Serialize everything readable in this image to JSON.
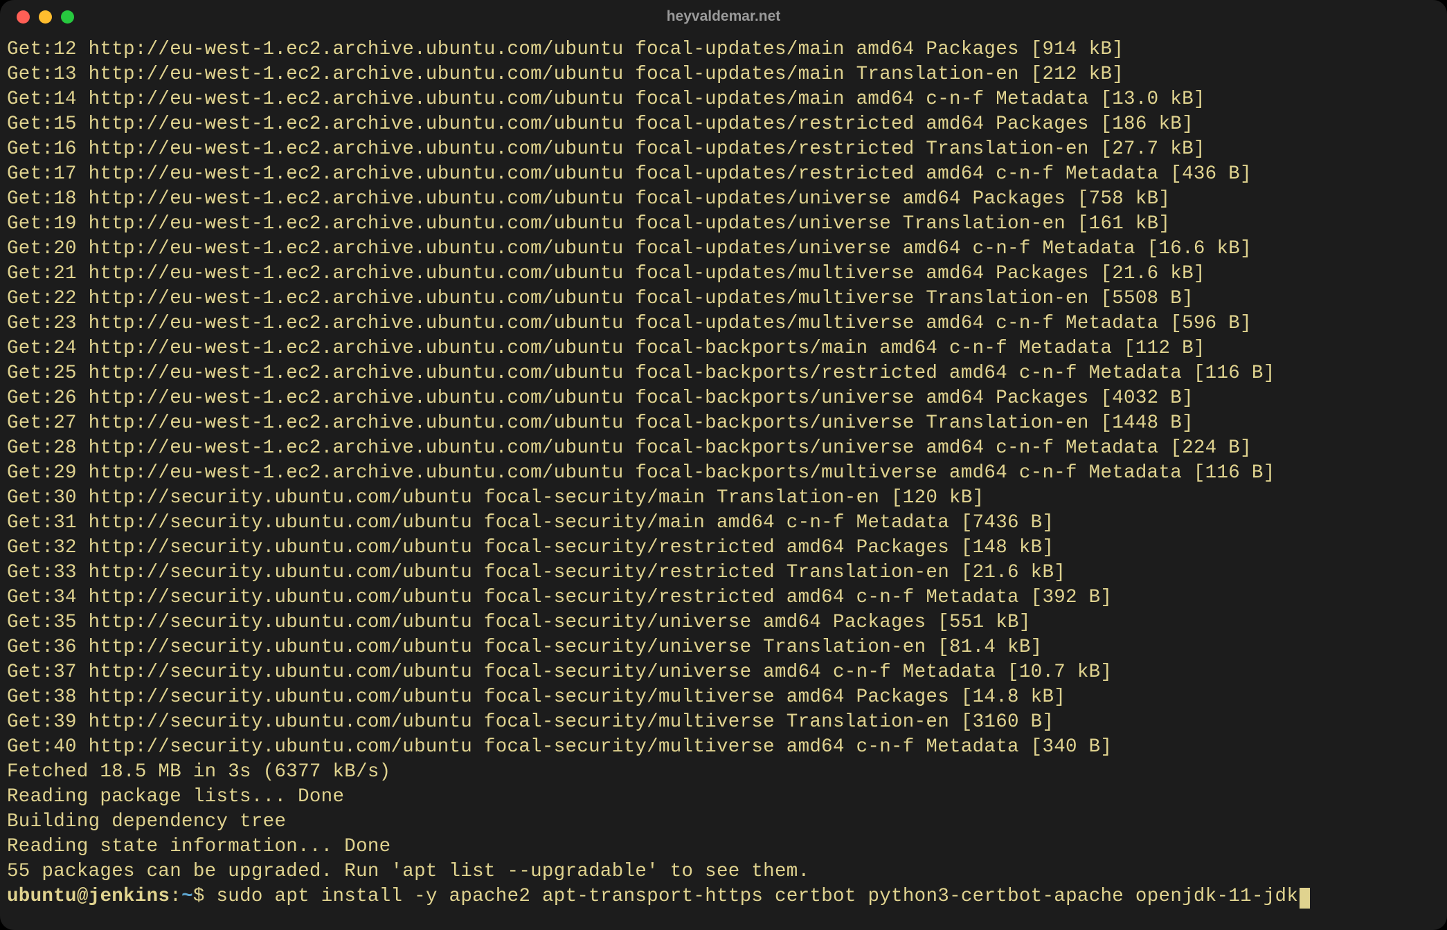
{
  "window": {
    "title": "heyvaldemar.net"
  },
  "lines": [
    "Get:12 http://eu-west-1.ec2.archive.ubuntu.com/ubuntu focal-updates/main amd64 Packages [914 kB]",
    "Get:13 http://eu-west-1.ec2.archive.ubuntu.com/ubuntu focal-updates/main Translation-en [212 kB]",
    "Get:14 http://eu-west-1.ec2.archive.ubuntu.com/ubuntu focal-updates/main amd64 c-n-f Metadata [13.0 kB]",
    "Get:15 http://eu-west-1.ec2.archive.ubuntu.com/ubuntu focal-updates/restricted amd64 Packages [186 kB]",
    "Get:16 http://eu-west-1.ec2.archive.ubuntu.com/ubuntu focal-updates/restricted Translation-en [27.7 kB]",
    "Get:17 http://eu-west-1.ec2.archive.ubuntu.com/ubuntu focal-updates/restricted amd64 c-n-f Metadata [436 B]",
    "Get:18 http://eu-west-1.ec2.archive.ubuntu.com/ubuntu focal-updates/universe amd64 Packages [758 kB]",
    "Get:19 http://eu-west-1.ec2.archive.ubuntu.com/ubuntu focal-updates/universe Translation-en [161 kB]",
    "Get:20 http://eu-west-1.ec2.archive.ubuntu.com/ubuntu focal-updates/universe amd64 c-n-f Metadata [16.6 kB]",
    "Get:21 http://eu-west-1.ec2.archive.ubuntu.com/ubuntu focal-updates/multiverse amd64 Packages [21.6 kB]",
    "Get:22 http://eu-west-1.ec2.archive.ubuntu.com/ubuntu focal-updates/multiverse Translation-en [5508 B]",
    "Get:23 http://eu-west-1.ec2.archive.ubuntu.com/ubuntu focal-updates/multiverse amd64 c-n-f Metadata [596 B]",
    "Get:24 http://eu-west-1.ec2.archive.ubuntu.com/ubuntu focal-backports/main amd64 c-n-f Metadata [112 B]",
    "Get:25 http://eu-west-1.ec2.archive.ubuntu.com/ubuntu focal-backports/restricted amd64 c-n-f Metadata [116 B]",
    "Get:26 http://eu-west-1.ec2.archive.ubuntu.com/ubuntu focal-backports/universe amd64 Packages [4032 B]",
    "Get:27 http://eu-west-1.ec2.archive.ubuntu.com/ubuntu focal-backports/universe Translation-en [1448 B]",
    "Get:28 http://eu-west-1.ec2.archive.ubuntu.com/ubuntu focal-backports/universe amd64 c-n-f Metadata [224 B]",
    "Get:29 http://eu-west-1.ec2.archive.ubuntu.com/ubuntu focal-backports/multiverse amd64 c-n-f Metadata [116 B]",
    "Get:30 http://security.ubuntu.com/ubuntu focal-security/main Translation-en [120 kB]",
    "Get:31 http://security.ubuntu.com/ubuntu focal-security/main amd64 c-n-f Metadata [7436 B]",
    "Get:32 http://security.ubuntu.com/ubuntu focal-security/restricted amd64 Packages [148 kB]",
    "Get:33 http://security.ubuntu.com/ubuntu focal-security/restricted Translation-en [21.6 kB]",
    "Get:34 http://security.ubuntu.com/ubuntu focal-security/restricted amd64 c-n-f Metadata [392 B]",
    "Get:35 http://security.ubuntu.com/ubuntu focal-security/universe amd64 Packages [551 kB]",
    "Get:36 http://security.ubuntu.com/ubuntu focal-security/universe Translation-en [81.4 kB]",
    "Get:37 http://security.ubuntu.com/ubuntu focal-security/universe amd64 c-n-f Metadata [10.7 kB]",
    "Get:38 http://security.ubuntu.com/ubuntu focal-security/multiverse amd64 Packages [14.8 kB]",
    "Get:39 http://security.ubuntu.com/ubuntu focal-security/multiverse Translation-en [3160 B]",
    "Get:40 http://security.ubuntu.com/ubuntu focal-security/multiverse amd64 c-n-f Metadata [340 B]",
    "Fetched 18.5 MB in 3s (6377 kB/s)",
    "Reading package lists... Done",
    "Building dependency tree",
    "Reading state information... Done",
    "55 packages can be upgraded. Run 'apt list --upgradable' to see them."
  ],
  "prompt": {
    "user": "ubuntu",
    "host": "jenkins",
    "path": "~",
    "command": "sudo apt install -y apache2 apt-transport-https certbot python3-certbot-apache openjdk-11-jdk"
  }
}
